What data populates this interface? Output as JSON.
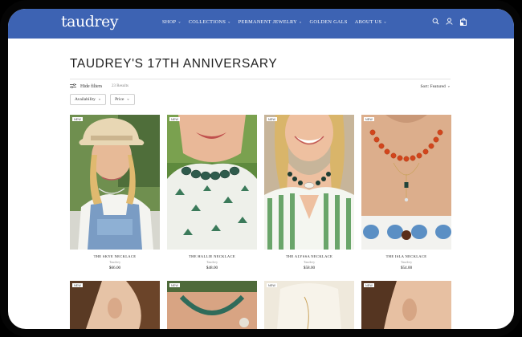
{
  "brand": {
    "logo": "taudrey"
  },
  "nav": {
    "items": [
      {
        "label": "SHOP",
        "dropdown": true
      },
      {
        "label": "COLLECTIONS",
        "dropdown": true
      },
      {
        "label": "PERMANENT JEWELRY",
        "dropdown": true
      },
      {
        "label": "GOLDEN GALS",
        "dropdown": false
      },
      {
        "label": "ABOUT US",
        "dropdown": true
      }
    ],
    "icons": [
      "search-icon",
      "account-icon",
      "cart-icon"
    ],
    "chevron": "⌄"
  },
  "page": {
    "title": "TAUDREY'S 17TH ANNIVERSARY"
  },
  "filters": {
    "hide_label": "Hide filters",
    "results": "23 Results",
    "sort_label": "Sort: Featured",
    "dropdowns": [
      "Availability",
      "Price"
    ]
  },
  "products": [
    {
      "badge": "NEW",
      "name": "THE SKYE NECKLACE",
      "brand": "Taudrey",
      "price": "$66.00"
    },
    {
      "badge": "NEW",
      "name": "THE HALLIE NECKLACE",
      "brand": "Taudrey",
      "price": "$48.00"
    },
    {
      "badge": "NEW",
      "name": "THE ALYSSA NECKLACE",
      "brand": "Taudrey",
      "price": "$58.00"
    },
    {
      "badge": "NEW",
      "name": "THE ISLA NECKLACE",
      "brand": "Taudrey",
      "price": "$54.00"
    }
  ],
  "products_row2": [
    {
      "badge": "NEW"
    },
    {
      "badge": "NEW"
    },
    {
      "badge": "NEW"
    },
    {
      "badge": "NEW"
    }
  ],
  "colors": {
    "nav_bg": "#3d63b3",
    "text": "#1f1f1f",
    "muted": "#999999"
  }
}
